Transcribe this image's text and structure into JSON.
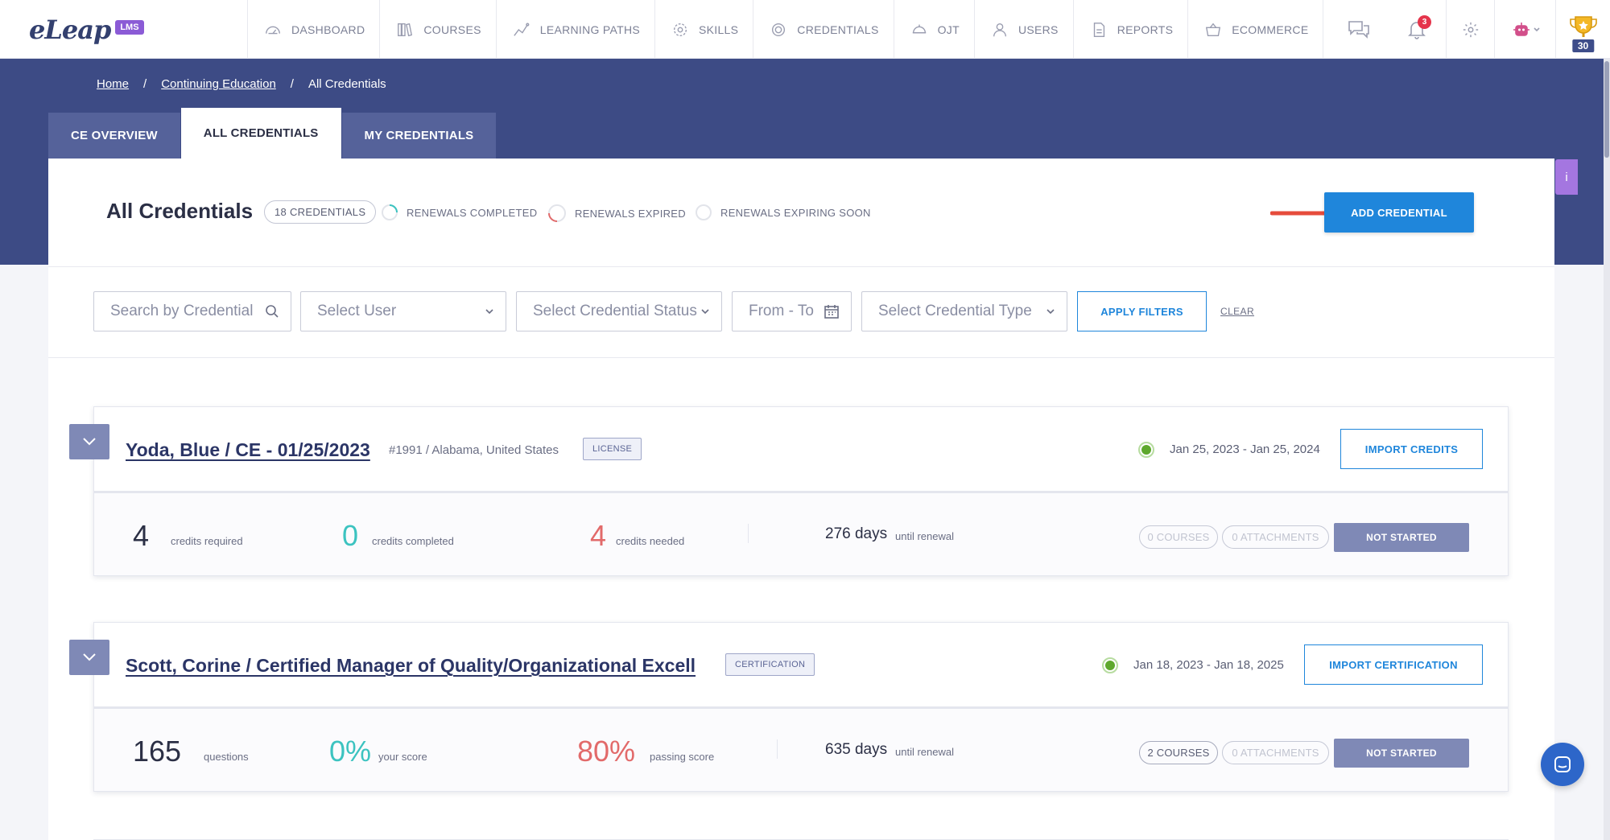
{
  "logo": {
    "word": "eLeap",
    "badge": "LMS"
  },
  "nav": [
    {
      "label": "DASHBOARD",
      "icon": "dashboard-icon"
    },
    {
      "label": "COURSES",
      "icon": "books-icon"
    },
    {
      "label": "LEARNING PATHS",
      "icon": "path-icon"
    },
    {
      "label": "SKILLS",
      "icon": "skills-icon"
    },
    {
      "label": "CREDENTIALS",
      "icon": "credential-icon"
    },
    {
      "label": "OJT",
      "icon": "ojt-icon"
    },
    {
      "label": "USERS",
      "icon": "user-icon"
    },
    {
      "label": "REPORTS",
      "icon": "report-icon"
    },
    {
      "label": "ECOMMERCE",
      "icon": "basket-icon"
    }
  ],
  "topright": {
    "notification_count": "3",
    "trophy_count": "30"
  },
  "breadcrumb": {
    "home": "Home",
    "section": "Continuing Education",
    "current": "All Credentials",
    "sep": "/"
  },
  "tabs": [
    {
      "label": "CE OVERVIEW"
    },
    {
      "label": "ALL CREDENTIALS"
    },
    {
      "label": "MY CREDENTIALS"
    }
  ],
  "side_tab": "i",
  "header": {
    "title": "All Credentials",
    "count": "18 CREDENTIALS",
    "legend": [
      "RENEWALS COMPLETED",
      "RENEWALS EXPIRED",
      "RENEWALS EXPIRING SOON"
    ],
    "add_button": "ADD CREDENTIAL"
  },
  "filters": {
    "search_placeholder": "Search by Credential",
    "user": "Select User",
    "status": "Select Credential Status",
    "date": "From - To",
    "type": "Select Credential Type",
    "apply": "APPLY FILTERS",
    "clear": "CLEAR"
  },
  "credentials": [
    {
      "name": "Yoda, Blue / CE - 01/25/2023",
      "meta": "#1991 / Alabama, United States",
      "type": "LICENSE",
      "dates": "Jan 25, 2023 - Jan 25, 2024",
      "import_label": "IMPORT CREDITS",
      "stats": [
        {
          "value": "4",
          "label": "credits required"
        },
        {
          "value": "0",
          "label": "credits completed"
        },
        {
          "value": "4",
          "label": "credits needed"
        }
      ],
      "days": "276 days",
      "days_label": "until renewal",
      "courses": "0 COURSES",
      "attachments": "0 ATTACHMENTS",
      "status": "NOT STARTED"
    },
    {
      "name": "Scott, Corine / Certified Manager of Quality/Organizational Excell",
      "meta": "",
      "type": "CERTIFICATION",
      "dates": "Jan 18, 2023 - Jan 18, 2025",
      "import_label": "IMPORT CERTIFICATION",
      "stats": [
        {
          "value": "165",
          "label": "questions"
        },
        {
          "value": "0%",
          "label": "your score"
        },
        {
          "value": "80%",
          "label": "passing score"
        }
      ],
      "days": "635 days",
      "days_label": "until renewal",
      "courses": "2 COURSES",
      "attachments": "0 ATTACHMENTS",
      "status": "NOT STARTED"
    }
  ]
}
